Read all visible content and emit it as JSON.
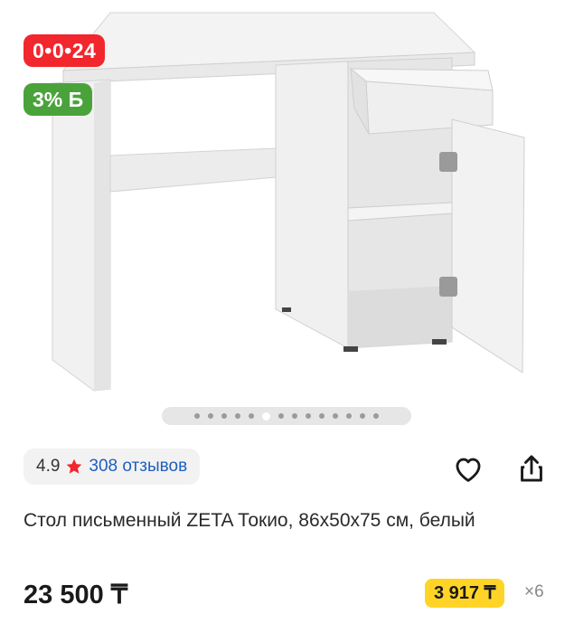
{
  "badges": {
    "timer": "0•0•24",
    "bonus": "3% Б"
  },
  "gallery": {
    "image": "desk-photo",
    "slides_count": 14,
    "active_slide": 5
  },
  "rating": {
    "score": "4.9",
    "reviews": "308 отзывов"
  },
  "actions": {
    "favorite_icon": "heart-icon",
    "share_icon": "share-icon"
  },
  "product": {
    "title": "Стол письменный ZETA Токио, 86x50x75 см, белый",
    "price": "23 500 ₸",
    "installment": "3 917 ₸",
    "installment_months": "×6"
  },
  "colors": {
    "timer_badge": "#f2262d",
    "bonus_badge": "#4aa33a",
    "installment_badge": "#ffd426",
    "link": "#1f5fbf",
    "star": "#f2262d"
  }
}
